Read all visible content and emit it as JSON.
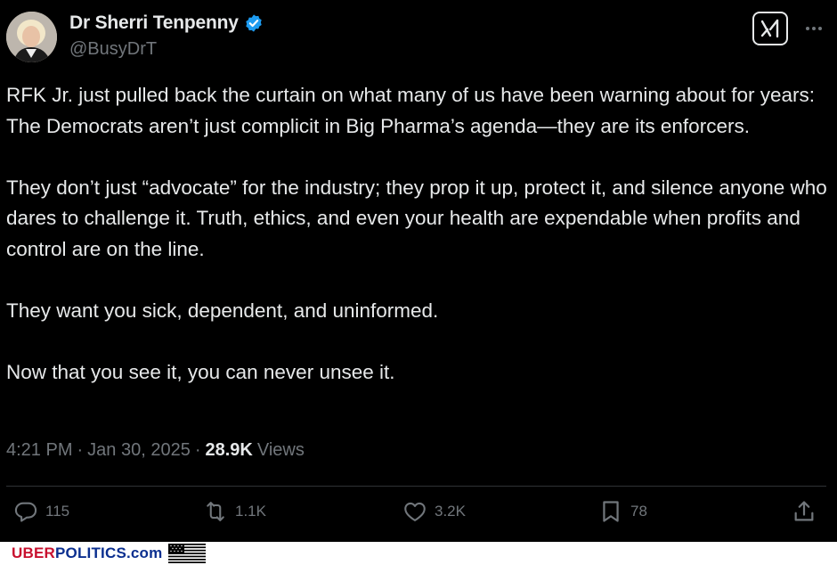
{
  "author": {
    "name": "Dr Sherri Tenpenny",
    "handle": "@BusyDrT",
    "avatar_icon": "avatar-photo",
    "verified_icon": "verified-badge-icon",
    "verified_color": "#1d9bf0"
  },
  "header": {
    "grok_icon": "grok-icon",
    "more_icon": "more-dots-icon"
  },
  "post": {
    "paragraphs": [
      "RFK Jr. just pulled back the curtain on what many of us have been warning about for years: The Democrats aren’t just complicit in Big Pharma’s agenda—they are its enforcers.",
      "They don’t just “advocate” for the industry; they prop it up, protect it, and silence anyone who dares to challenge it. Truth, ethics, and even your health are expendable when profits and control are on the line.",
      "They want you sick, dependent, and uninformed.",
      "Now that you see it, you can never unsee it."
    ],
    "time": "4:21 PM",
    "sep1": "·",
    "date": "Jan 30, 2025",
    "sep2": "·",
    "views_count": "28.9K",
    "views_label": "Views"
  },
  "actions": {
    "replies": {
      "icon": "reply-icon",
      "count": "115"
    },
    "reposts": {
      "icon": "repost-icon",
      "count": "1.1K"
    },
    "likes": {
      "icon": "like-icon",
      "count": "3.2K"
    },
    "bookmarks": {
      "icon": "bookmark-icon",
      "count": "78"
    },
    "share": {
      "icon": "share-icon"
    }
  },
  "footer": {
    "brand_part1": "UBER",
    "brand_part2": "POLITICS.com",
    "brand_color1": "#c8102e",
    "brand_color2": "#0b2f8f",
    "flag_icon": "us-flag-icon"
  }
}
